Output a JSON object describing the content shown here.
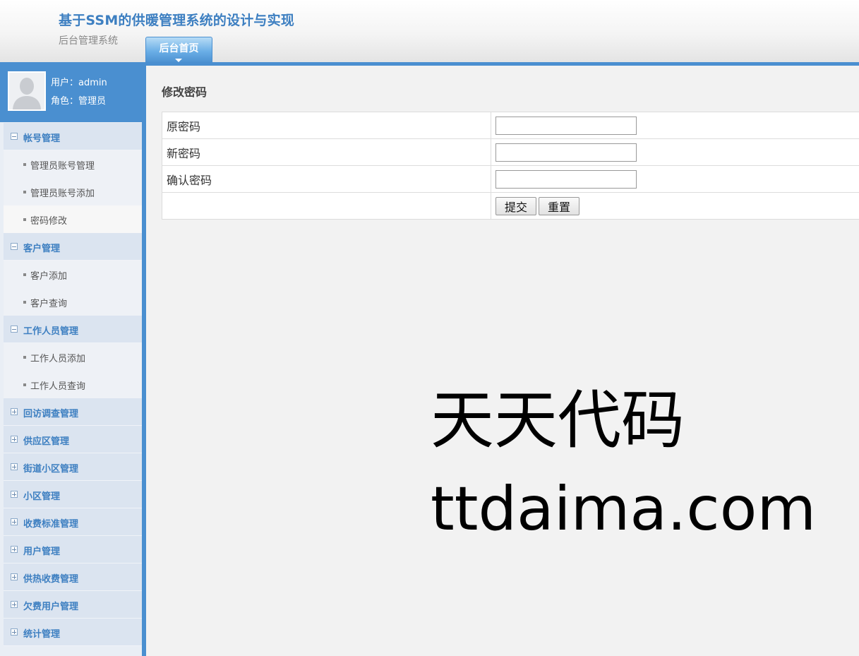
{
  "header": {
    "title": "基于SSM的供暖管理系统的设计与实现",
    "subtitle": "后台管理系统",
    "tab_label": "后台首页"
  },
  "user": {
    "name_line": "用户：admin",
    "role_line": "角色：管理员"
  },
  "menu": [
    {
      "label": "帐号管理",
      "expanded": true,
      "items": [
        {
          "label": "管理员账号管理"
        },
        {
          "label": "管理员账号添加"
        },
        {
          "label": "密码修改",
          "active": true
        }
      ]
    },
    {
      "label": "客户管理",
      "expanded": true,
      "items": [
        {
          "label": "客户添加"
        },
        {
          "label": "客户查询"
        }
      ]
    },
    {
      "label": "工作人员管理",
      "expanded": true,
      "items": [
        {
          "label": "工作人员添加"
        },
        {
          "label": "工作人员查询"
        }
      ]
    },
    {
      "label": "回访调查管理",
      "expanded": false
    },
    {
      "label": "供应区管理",
      "expanded": false
    },
    {
      "label": "街道小区管理",
      "expanded": false
    },
    {
      "label": "小区管理",
      "expanded": false
    },
    {
      "label": "收费标准管理",
      "expanded": false
    },
    {
      "label": "用户管理",
      "expanded": false
    },
    {
      "label": "供热收费管理",
      "expanded": false
    },
    {
      "label": "欠费用户管理",
      "expanded": false
    },
    {
      "label": "统计管理",
      "expanded": false
    }
  ],
  "main": {
    "title": "修改密码",
    "fields": {
      "old_password": {
        "label": "原密码",
        "value": ""
      },
      "new_password": {
        "label": "新密码",
        "value": ""
      },
      "confirm_password": {
        "label": "确认密码",
        "value": ""
      }
    },
    "buttons": {
      "submit": "提交",
      "reset": "重置"
    }
  },
  "watermark": {
    "line1": "天天代码",
    "line2": "ttdaima.com"
  },
  "colors": {
    "accent": "#4a8fd0",
    "title": "#3d7fc1",
    "menu_bg": "#dbe4f0"
  }
}
